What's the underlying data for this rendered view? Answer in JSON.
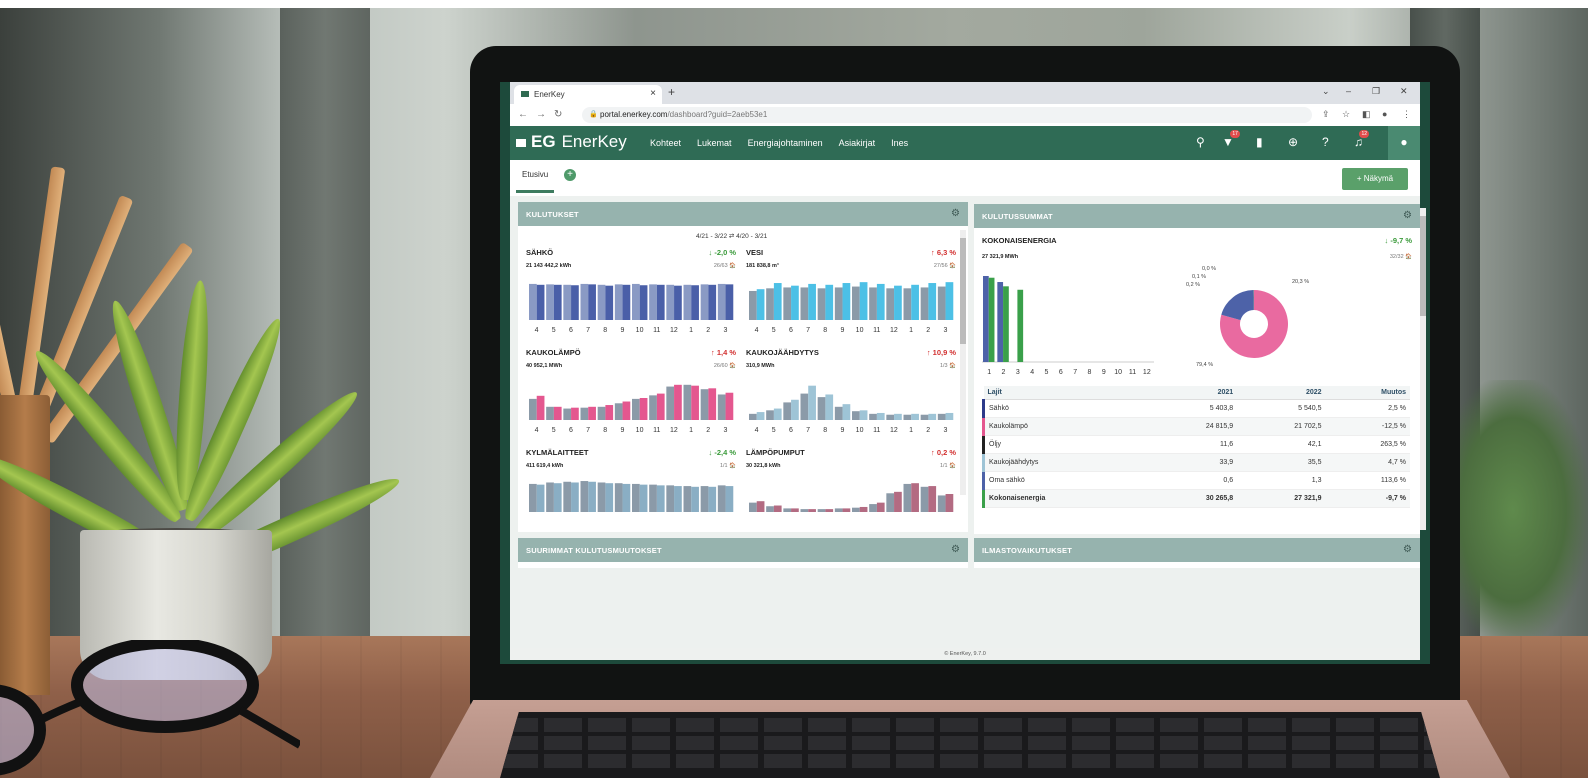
{
  "browser": {
    "tab_title": "EnerKey",
    "new_tab": "+",
    "url_host": "portal.enerkey.com",
    "url_path": "/dashboard?guid=2aeb53e1"
  },
  "app": {
    "logo_eg": "EG",
    "logo_name": "EnerKey",
    "nav": [
      "Kohteet",
      "Lukemat",
      "Energiajohtaminen",
      "Asiakirjat",
      "Ines"
    ],
    "badges": {
      "filter": "17",
      "notifications": "12"
    }
  },
  "page": {
    "tab": "Etusivu",
    "add_tab": "+",
    "view_button": "+ Näkymä",
    "footer": "© EnerKey, 9.7.0"
  },
  "consumption_panel": {
    "title": "KULUTUKSET",
    "period": "4/21 - 3/22 ⇄ 4/20 - 3/21",
    "months": [
      "4",
      "5",
      "6",
      "7",
      "8",
      "9",
      "10",
      "11",
      "12",
      "1",
      "2",
      "3"
    ],
    "items": [
      {
        "name": "SÄHKÖ",
        "value": "21 143 442,2 kWh",
        "change": "↓ -2,0 %",
        "dir": "down",
        "feeds": "26/63 🏠",
        "color": "#4a5fa8",
        "prev_color": "#8a9ac4",
        "current": [
          80,
          80,
          79,
          81,
          78,
          80,
          79,
          80,
          78,
          79,
          80,
          81
        ],
        "previous": [
          82,
          81,
          80,
          82,
          80,
          81,
          82,
          81,
          80,
          80,
          81,
          82
        ]
      },
      {
        "name": "VESI",
        "value": "181 838,8 m³",
        "change": "↑ 6,3 %",
        "dir": "up",
        "feeds": "27/56 🏠",
        "color": "#4cc0e6",
        "prev_color": "#8b9aa8",
        "current": [
          70,
          84,
          78,
          82,
          80,
          84,
          86,
          82,
          78,
          80,
          84,
          86
        ],
        "previous": [
          66,
          72,
          74,
          74,
          72,
          74,
          76,
          74,
          72,
          72,
          74,
          76
        ]
      },
      {
        "name": "KAUKOLÄMPÖ",
        "value": "40 952,1 MWh",
        "change": "↑ 1,4 %",
        "dir": "up",
        "feeds": "26/60 🏠",
        "color": "#e4578f",
        "prev_color": "#8b9aa8",
        "current": [
          55,
          30,
          28,
          30,
          34,
          42,
          50,
          60,
          80,
          78,
          72,
          62
        ],
        "previous": [
          48,
          30,
          26,
          28,
          30,
          38,
          48,
          56,
          76,
          80,
          70,
          58
        ]
      },
      {
        "name": "KAUKOJÄÄHDYTYS",
        "value": "310,9 MWh",
        "change": "↑ 10,9 %",
        "dir": "up",
        "feeds": "1/3 🏠",
        "color": "#9ec4d6",
        "prev_color": "#8b9aa8",
        "current": [
          18,
          26,
          46,
          78,
          58,
          36,
          22,
          16,
          14,
          14,
          14,
          16
        ],
        "previous": [
          14,
          22,
          40,
          60,
          52,
          30,
          20,
          14,
          12,
          12,
          12,
          14
        ]
      },
      {
        "name": "KYLMÄLAITTEET",
        "value": "411 619,4 kWh",
        "change": "↓ -2,4 %",
        "dir": "down",
        "feeds": "1/1 🏠",
        "color": "#8aaec4",
        "prev_color": "#8b9aa8",
        "current": [
          76,
          80,
          82,
          84,
          80,
          78,
          76,
          74,
          72,
          70,
          70,
          72
        ],
        "previous": [
          78,
          82,
          84,
          86,
          82,
          80,
          78,
          76,
          74,
          72,
          72,
          74
        ]
      },
      {
        "name": "LÄMPÖPUMPUT",
        "value": "30 321,8 kWh",
        "change": "↑ 0,2 %",
        "dir": "up",
        "feeds": "1/1 🏠",
        "color": "#b36b82",
        "prev_color": "#8b9aa8",
        "current": [
          30,
          18,
          10,
          8,
          8,
          10,
          14,
          26,
          56,
          80,
          72,
          50
        ],
        "previous": [
          26,
          16,
          10,
          8,
          8,
          10,
          12,
          22,
          52,
          78,
          70,
          46
        ]
      }
    ]
  },
  "totals_panel": {
    "title": "KULUTUSSUMMAT",
    "heading": "KOKONAISENERGIA",
    "value": "27 321,9 MWh",
    "change": "↓ -9,7 %",
    "feeds": "32/32 🏠",
    "x_months": [
      "1",
      "2",
      "3",
      "4",
      "5",
      "6",
      "7",
      "8",
      "9",
      "10",
      "11",
      "12"
    ],
    "bars_2021": [
      100,
      93,
      0
    ],
    "bars_2022": [
      98,
      88,
      84
    ],
    "pie": [
      {
        "label": "79,4 %",
        "value": 79.4,
        "color": "#e96aa0"
      },
      {
        "label": "20,3 %",
        "value": 20.3,
        "color": "#4d62a8"
      },
      {
        "label": "0,2 %",
        "value": 0.2,
        "color": "#333333"
      },
      {
        "label": "0,1 %",
        "value": 0.1,
        "color": "#9ec4d6"
      },
      {
        "label": "0,0 %",
        "value": 0.0,
        "color": "#6da0d0"
      }
    ],
    "table": {
      "headers": [
        "Lajit",
        "2021",
        "2022",
        "Muutos"
      ],
      "rows": [
        {
          "name": "Sähkö",
          "y2021": "5 403,8",
          "y2022": "5 540,5",
          "change": "2,5 %",
          "color": "#2d3b8a"
        },
        {
          "name": "Kaukolämpö",
          "y2021": "24 815,9",
          "y2022": "21 702,5",
          "change": "-12,5 %",
          "color": "#e4578f"
        },
        {
          "name": "Öljy",
          "y2021": "11,6",
          "y2022": "42,1",
          "change": "263,5 %",
          "color": "#222222"
        },
        {
          "name": "Kaukojäähdytys",
          "y2021": "33,9",
          "y2022": "35,5",
          "change": "4,7 %",
          "color": "#9ec4d6"
        },
        {
          "name": "Oma sähkö",
          "y2021": "0,6",
          "y2022": "1,3",
          "change": "113,6 %",
          "color": "#4d62a8"
        },
        {
          "name": "Kokonaisenergia",
          "y2021": "30 265,8",
          "y2022": "27 321,9",
          "change": "-9,7 %",
          "color": "#3aa04a",
          "total": true
        }
      ]
    }
  },
  "bottom_panels": {
    "left": "SUURIMMAT KULUTUSMUUTOKSET",
    "right": "ILMASTOVAIKUTUKSET"
  }
}
